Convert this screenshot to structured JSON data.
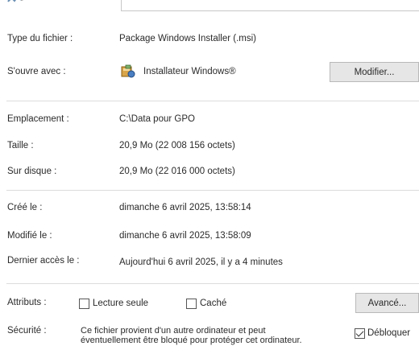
{
  "general": {
    "file_type_label": "Type du fichier :",
    "file_type_value": "Package Windows Installer (.msi)",
    "opens_with_label": "S'ouvre avec :",
    "opens_with_value": "Installateur Windows®",
    "change_button": "Modifier...",
    "location_label": "Emplacement :",
    "location_value": "C:\\Data pour GPO",
    "size_label": "Taille :",
    "size_value": "20,9 Mo (22 008 156 octets)",
    "size_on_disk_label": "Sur disque :",
    "size_on_disk_value": "20,9 Mo (22 016 000 octets)",
    "created_label": "Créé le :",
    "created_value": "dimanche 6 avril 2025, 13:58:14",
    "modified_label": "Modifié le :",
    "modified_value": "dimanche 6 avril 2025, 13:58:09",
    "accessed_label": "Dernier accès le :",
    "accessed_value": "Aujourd'hui 6 avril 2025, il y a 4 minutes"
  },
  "attributes": {
    "label": "Attributs :",
    "readonly_label": "Lecture seule",
    "readonly_checked": false,
    "hidden_label": "Caché",
    "hidden_checked": false,
    "advanced_button": "Avancé..."
  },
  "security": {
    "label": "Sécurité :",
    "text_line1": "Ce fichier provient d'un autre ordinateur et peut",
    "text_line2": "éventuellement être bloqué pour protéger cet ordinateur.",
    "unblock_label": "Débloquer",
    "unblock_checked": true
  }
}
